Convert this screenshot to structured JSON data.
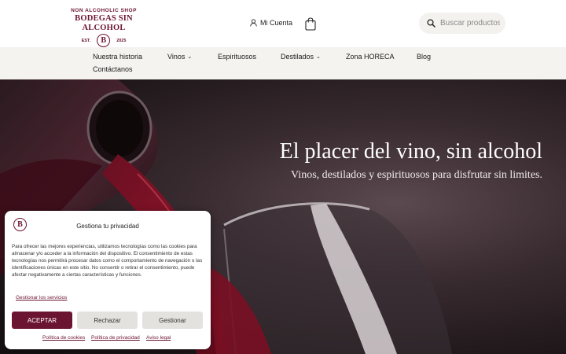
{
  "brand": {
    "tagline": "NON ALCOHOLIC SHOP",
    "name": "BODEGAS SIN ALCOHOL",
    "est_label": "EST.",
    "badge_letter": "B",
    "year": "2025",
    "color": "#6b1431"
  },
  "header": {
    "account_label": "Mi Cuenta",
    "account_icon": "user-icon",
    "cart_icon": "shopping-bag-icon",
    "search_placeholder": "Buscar productos",
    "search_icon": "search-icon"
  },
  "nav": {
    "items": [
      {
        "label": "Nuestra historia"
      },
      {
        "label": "Vinos",
        "chevron": "⌄"
      },
      {
        "label": "Espirituosos"
      },
      {
        "label": "Destilados",
        "chevron": "⌄"
      },
      {
        "label": "Zona HORECA"
      },
      {
        "label": "Blog"
      },
      {
        "label": "Contáctanos"
      }
    ]
  },
  "hero": {
    "title": "El placer del vino, sin alcohol",
    "subtitle": "Vinos, destilados y espirituosos para disfrutar sin limites."
  },
  "consent": {
    "logo_letter": "B",
    "title": "Gestiona tu privacidad",
    "text": "Para ofrecer las mejores experiencias, utilizamos tecnologías como las cookies para almacenar y/o acceder a la información del dispositivo. El consentimiento de estas tecnologías nos permitirá procesar datos como el comportamiento de navegación o las identificaciones únicas en este sitio. No consentir o retirar el consentimiento, puede afectar negativamente a ciertas características y funciones.",
    "manage_services": "Gestionar los servicios",
    "accept": "ACEPTAR",
    "reject": "Rechazar",
    "manage": "Gestionar",
    "links": [
      "Política de cookies",
      "Política de privacidad",
      "Aviso legal"
    ]
  }
}
